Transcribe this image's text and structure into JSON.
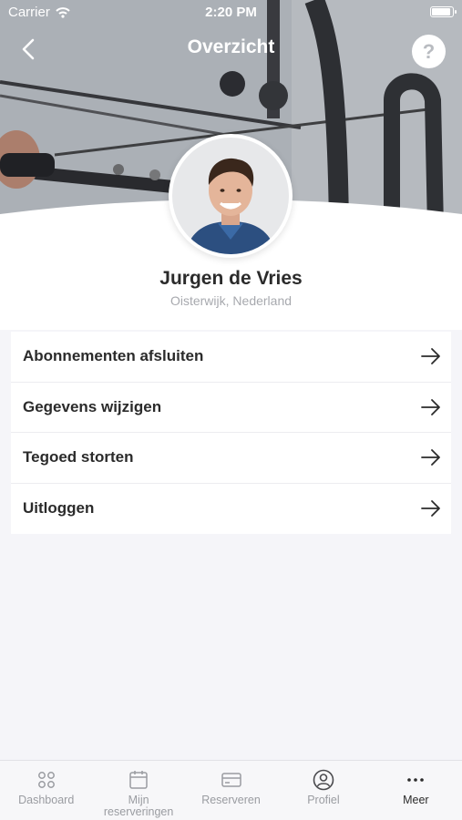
{
  "status_bar": {
    "carrier": "Carrier",
    "time": "2:20 PM"
  },
  "nav": {
    "title": "Overzicht",
    "back_icon": "chevron-left-icon",
    "help_label": "?"
  },
  "profile": {
    "name": "Jurgen de Vries",
    "location": "Oisterwijk, Nederland"
  },
  "menu": {
    "items": [
      {
        "label": "Abonnementen afsluiten",
        "icon": "arrow-right-icon"
      },
      {
        "label": "Gegevens wijzigen",
        "icon": "arrow-right-icon"
      },
      {
        "label": "Tegoed storten",
        "icon": "arrow-right-icon"
      },
      {
        "label": "Uitloggen",
        "icon": "arrow-right-icon"
      }
    ]
  },
  "tab_bar": {
    "tabs": [
      {
        "label": "Dashboard",
        "icon": "dashboard-icon",
        "active": false
      },
      {
        "label_line1": "Mijn",
        "label_line2": "reserveringen",
        "icon": "calendar-icon",
        "active": false
      },
      {
        "label": "Reserveren",
        "icon": "card-icon",
        "active": false
      },
      {
        "label": "Profiel",
        "icon": "profile-icon",
        "active": false
      },
      {
        "label": "Meer",
        "icon": "more-icon",
        "active": true
      }
    ]
  },
  "colors": {
    "background": "#f5f5f9",
    "text_primary": "#2b2b2b",
    "text_secondary": "#a7a9ae",
    "tab_inactive": "#9a9ca1"
  }
}
